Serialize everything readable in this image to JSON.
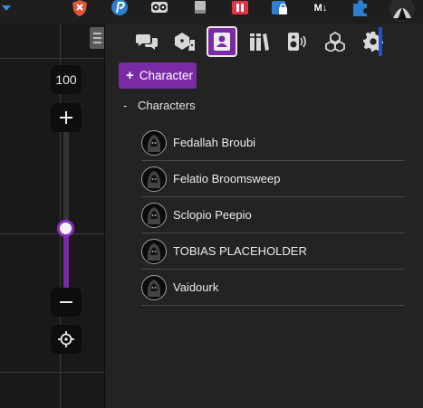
{
  "colors": {
    "accent": "#7b2aa6",
    "sidebar_bg": "#232323",
    "canvas_bg": "#191919"
  },
  "extensions": [
    {
      "icon": "menu-triangle-icon"
    },
    {
      "icon": "shield-x-icon"
    },
    {
      "icon": "p-circle-icon"
    },
    {
      "icon": "owl-icon"
    },
    {
      "icon": "document-icon"
    },
    {
      "icon": "pause-icon"
    },
    {
      "icon": "lock-badge-icon"
    },
    {
      "icon": "markdown-icon",
      "text": "M↓"
    },
    {
      "icon": "puzzle-icon"
    },
    {
      "icon": "profile-avatar-icon"
    }
  ],
  "zoom": {
    "level": "100",
    "plus_icon": "plus-icon",
    "minus_icon": "minus-icon",
    "center_icon": "crosshair-icon",
    "slider_fraction": 0.45
  },
  "sidebar": {
    "tabs": [
      {
        "name": "chat",
        "icon": "chat-bubbles-icon",
        "active": false
      },
      {
        "name": "combat",
        "icon": "dice-icon",
        "active": false
      },
      {
        "name": "actors",
        "icon": "actor-card-icon",
        "active": true
      },
      {
        "name": "items",
        "icon": "books-icon",
        "active": false
      },
      {
        "name": "playlists",
        "icon": "speaker-icon",
        "active": false
      },
      {
        "name": "compendium",
        "icon": "cubes-icon",
        "active": false
      },
      {
        "name": "settings",
        "icon": "gear-icon",
        "active": false
      }
    ],
    "add_button": {
      "plus": "+",
      "label": "Character"
    },
    "folder": {
      "toggle": "-",
      "name": "Characters"
    },
    "actors": [
      {
        "name": "Fedallah Broubi"
      },
      {
        "name": "Felatio Broomsweep"
      },
      {
        "name": "Sclopio Peepio"
      },
      {
        "name": "TOBIAS PLACEHOLDER"
      },
      {
        "name": "Vaidourk"
      }
    ]
  }
}
